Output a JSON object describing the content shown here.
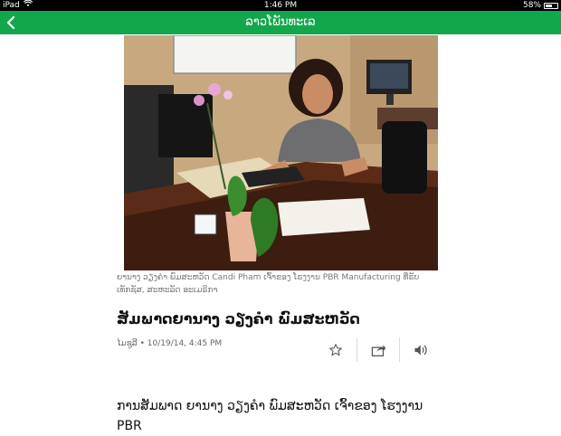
{
  "status_bar": {
    "device": "iPad",
    "time": "1:46 PM",
    "battery": "58%",
    "battery_fraction": 0.58,
    "wifi_icon": "wifi-icon"
  },
  "navbar": {
    "title": "ລາວໂພັນທະເລ",
    "back_icon": "chevron-left-icon",
    "color": "#13a74b"
  },
  "article": {
    "photo_icon": "article-photo",
    "caption": "ຍານາງ ວຽງຄຳ ພົມສະຫວັດ Candi Pham ເຈົ້າຂອງ ໂຮງງານ PBR Manufacturing ທີ່ຮັບ ເທັກຊັສ, ສະຫະລັດ ອະເມຣິກາ",
    "headline": "ສັມພາດຍານາງ ວຽງຄຳ ພົມສະຫວັດ",
    "byline": "ໄມຊູລີ • 10/19/14, 4:45 PM",
    "actions": {
      "favorite_icon": "star-icon",
      "share_icon": "share-icon",
      "audio_icon": "speaker-icon"
    },
    "body": "ການສັມພາດ ຍານາງ ວຽງຄຳ ພົມສະຫວັດ ເຈົ້າຂອງ ໂຮງງານ PBR"
  }
}
